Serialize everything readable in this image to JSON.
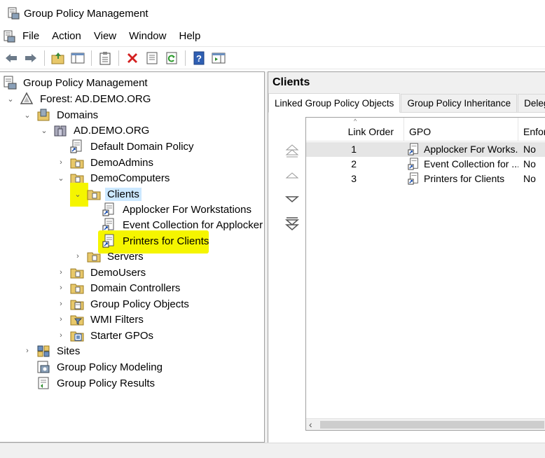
{
  "window": {
    "title": "Group Policy Management"
  },
  "menu": {
    "items": [
      "File",
      "Action",
      "View",
      "Window",
      "Help"
    ]
  },
  "toolbar": {
    "buttons": [
      "back-icon",
      "forward-icon",
      "up-folder-icon",
      "show-hide-tree-icon",
      "clipboard-icon",
      "delete-icon",
      "properties-icon",
      "refresh-icon",
      "help-icon",
      "action-pane-icon"
    ]
  },
  "tree": {
    "root": "Group Policy Management",
    "forest": "Forest: AD.DEMO.ORG",
    "domains": "Domains",
    "domain": "AD.DEMO.ORG",
    "default_policy": "Default Domain Policy",
    "demo_admins": "DemoAdmins",
    "demo_computers": "DemoComputers",
    "clients": "Clients",
    "gpo_links": [
      "Applocker For Workstations",
      "Event Collection for Applocker",
      "Printers for Clients"
    ],
    "servers": "Servers",
    "demo_users": "DemoUsers",
    "domain_controllers": "Domain Controllers",
    "gpo_objects": "Group Policy Objects",
    "wmi_filters": "WMI Filters",
    "starter_gpos": "Starter GPOs",
    "sites": "Sites",
    "modeling": "Group Policy Modeling",
    "results": "Group Policy Results"
  },
  "right": {
    "title": "Clients",
    "tabs": [
      "Linked Group Policy Objects",
      "Group Policy Inheritance",
      "Delega"
    ],
    "columns": {
      "link_order": "Link Order",
      "gpo": "GPO",
      "enforced": "Enfor"
    },
    "rows": [
      {
        "order": "1",
        "gpo": "Applocker For Works...",
        "enforced": "No"
      },
      {
        "order": "2",
        "gpo": "Event Collection for ...",
        "enforced": "No"
      },
      {
        "order": "3",
        "gpo": "Printers for Clients",
        "enforced": "No"
      }
    ]
  },
  "colors": {
    "highlight": "#f5f500",
    "selection": "#cce8ff"
  }
}
